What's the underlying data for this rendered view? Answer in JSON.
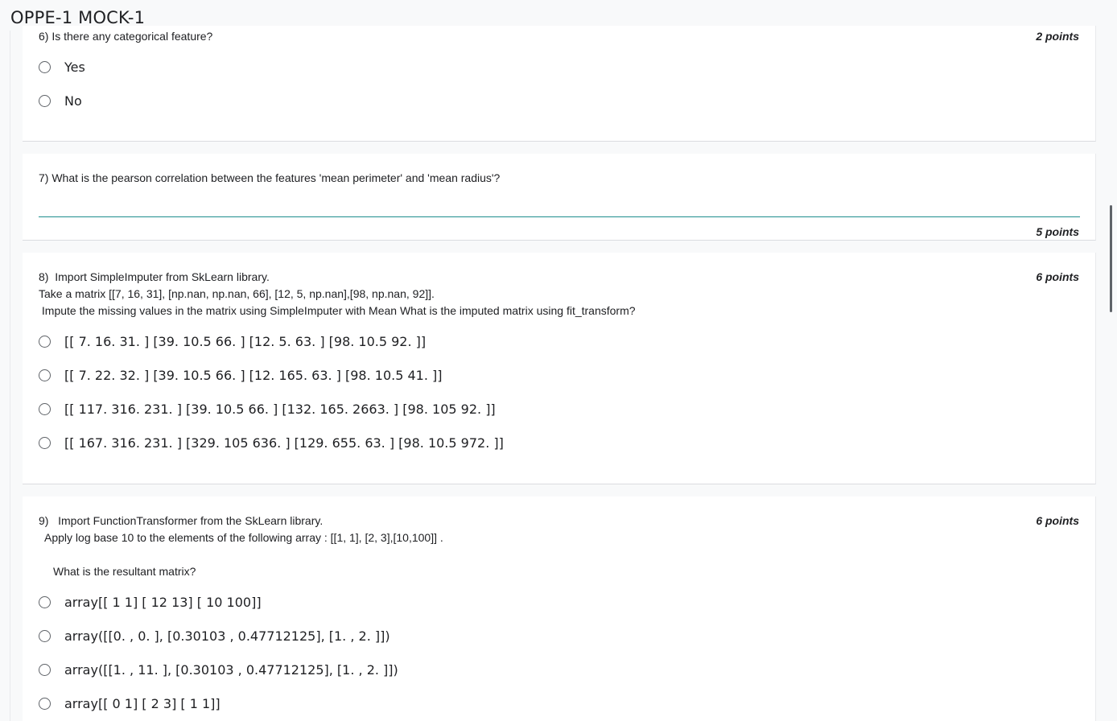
{
  "header": {
    "title": "OPPE-1 MOCK-1"
  },
  "questions": {
    "q6": {
      "text": "6) Is there any categorical feature?",
      "points": "2 points",
      "options": [
        "Yes",
        "No"
      ]
    },
    "q7": {
      "text": "7) What is the pearson correlation between the features 'mean perimeter' and 'mean radius'?",
      "points": "5 points",
      "answer": ""
    },
    "q8": {
      "line1": "8)  Import SimpleImputer from SkLearn library.",
      "line2": "Take a matrix [[7, 16, 31], [np.nan, np.nan, 66], [12, 5, np.nan],[98, np.nan, 92]].",
      "line3": " Impute the missing values in the matrix using SimpleImputer with Mean What is the imputed matrix using fit_transform?",
      "points": "6 points",
      "options": [
        "[[ 7. 16. 31. ] [39. 10.5 66. ] [12. 5. 63. ] [98. 10.5 92. ]]",
        "[[ 7. 22. 32. ] [39. 10.5 66. ] [12. 165. 63. ] [98. 10.5 41. ]]",
        "[[ 117. 316. 231. ] [39. 10.5 66. ] [132. 165. 2663. ] [98. 105 92. ]]",
        "[[ 167. 316. 231. ] [329. 105 636. ] [129. 655. 63. ] [98. 10.5 972. ]]"
      ]
    },
    "q9": {
      "line1": "9)   Import FunctionTransformer from the SkLearn library.",
      "line2": "  Apply log base 10 to the elements of the following array : [[1, 1], [2, 3],[10,100]] .",
      "line3": "What is the resultant matrix?",
      "points": "6 points",
      "options": [
        "array[[ 1 1] [ 12 13] [ 10 100]]",
        "array([[0. , 0. ], [0.30103 , 0.47712125], [1. , 2. ]])",
        "array([[1. , 11. ], [0.30103 , 0.47712125], [1. , 2. ]])",
        "array[[ 0 1] [ 2 3] [ 1 1]]"
      ]
    }
  }
}
